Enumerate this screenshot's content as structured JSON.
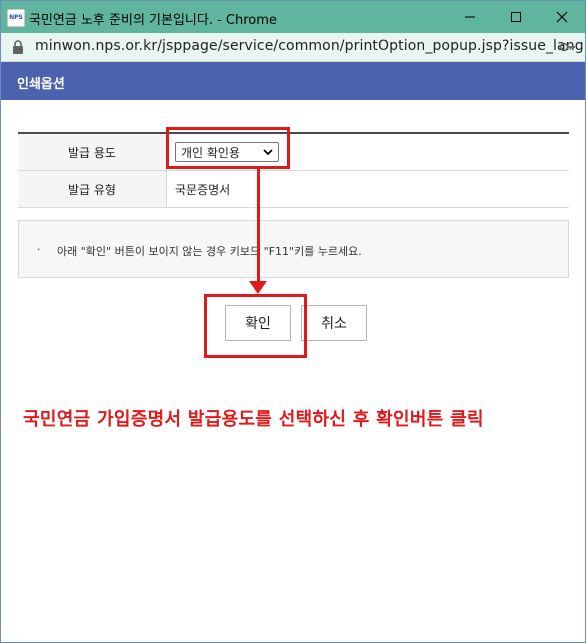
{
  "window": {
    "logo_text": "NPS",
    "title": "국민연금 노후 준비의 기본입니다. - Chrome"
  },
  "address_bar": {
    "url": "minwon.nps.or.kr/jsppage/service/common/printOption_popup.jsp?issue_lang=..."
  },
  "popup": {
    "header": "인쇄옵션",
    "rows": [
      {
        "label": "발급 용도",
        "value": "개인 확인용"
      },
      {
        "label": "발급 유형",
        "value": "국문증명서"
      }
    ],
    "notice": {
      "bullet": "·",
      "text": "아래 \"확인\" 버튼이 보이지 않는 경우 키보드 \"F11\"키를 누르세요."
    },
    "buttons": {
      "ok": "확인",
      "cancel": "취소"
    }
  },
  "annotation": {
    "instruction": "국민연금 가입증명서 발급용도를 선택하신 후 확인버튼 클릭",
    "color": "#e0191b"
  },
  "colors": {
    "titlebar": "#5fb59d",
    "popup_header": "#4a62b0"
  }
}
